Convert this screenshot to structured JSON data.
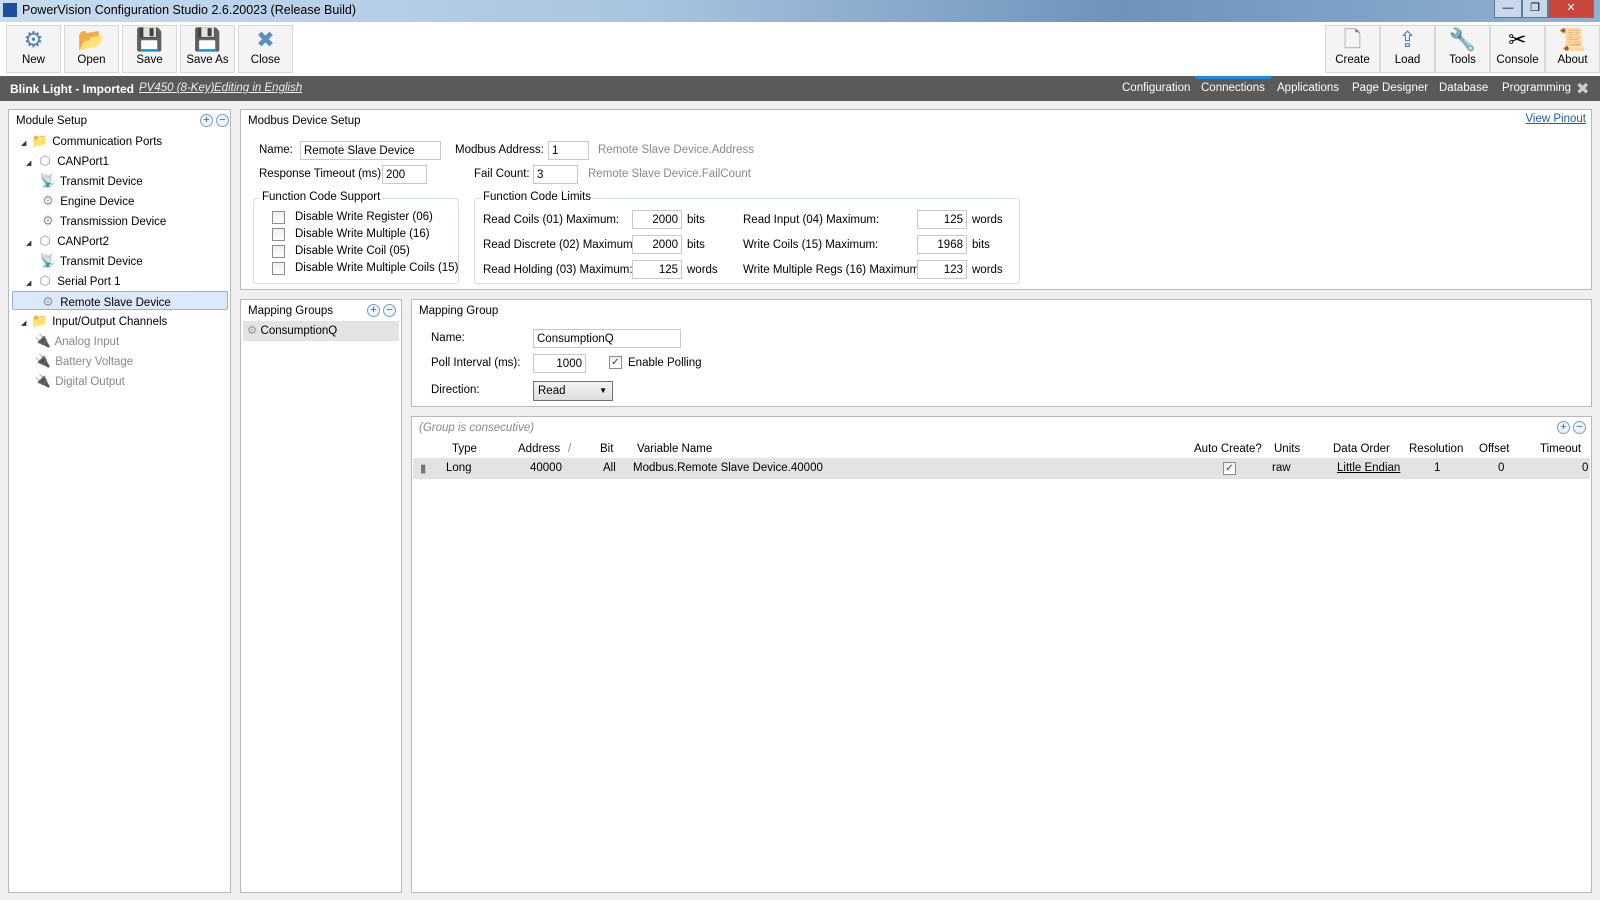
{
  "window": {
    "title": "PowerVision Configuration Studio 2.6.20023 (Release Build)",
    "minimize": "—",
    "restore": "❐",
    "close": "✕"
  },
  "toolbar": {
    "left": [
      {
        "label": "New",
        "icon": "gear-icon",
        "glyph": "⚙"
      },
      {
        "label": "Open",
        "icon": "folder-open-icon",
        "glyph": "📂"
      },
      {
        "label": "Save",
        "icon": "floppy-icon",
        "glyph": "💾"
      },
      {
        "label": "Save As",
        "icon": "floppy-pencil-icon",
        "glyph": "💾"
      },
      {
        "label": "Close",
        "icon": "close-x-icon",
        "glyph": "✖"
      }
    ],
    "right": [
      {
        "label": "Create",
        "icon": "new-file-icon",
        "glyph": "🗋"
      },
      {
        "label": "Load",
        "icon": "upload-icon",
        "glyph": "⇪"
      },
      {
        "label": "Tools",
        "icon": "tools-icon",
        "glyph": "🔧"
      },
      {
        "label": "Console",
        "icon": "screwdriver-wrench-icon",
        "glyph": "✂"
      },
      {
        "label": "About",
        "icon": "certificate-icon",
        "glyph": "📜"
      }
    ]
  },
  "project": {
    "name": "Blink Light - Imported",
    "device": "PV450 (8-Key)",
    "language": "Editing in English"
  },
  "nav": {
    "tabs": [
      "Configuration",
      "Connections",
      "Applications",
      "Page Designer",
      "Database",
      "Programming"
    ],
    "active": "Connections",
    "close": "✖"
  },
  "module_setup": {
    "title": "Module Setup",
    "items": [
      {
        "label": "Communication Ports",
        "icon": "folder-icon",
        "glyph": "📁"
      },
      {
        "label": "CANPort1",
        "icon": "port-icon",
        "glyph": "⬡"
      },
      {
        "label": "Transmit Device",
        "icon": "transmit-icon",
        "glyph": "📡"
      },
      {
        "label": "Engine Device",
        "icon": "gear-icon",
        "glyph": "⚙"
      },
      {
        "label": "Transmission Device",
        "icon": "gear-icon",
        "glyph": "⚙"
      },
      {
        "label": "CANPort2",
        "icon": "port-icon",
        "glyph": "⬡"
      },
      {
        "label": "Transmit Device",
        "icon": "transmit-icon",
        "glyph": "📡"
      },
      {
        "label": "Serial Port 1",
        "icon": "port-icon",
        "glyph": "⬡"
      },
      {
        "label": "Remote Slave Device",
        "icon": "gear-icon",
        "glyph": "⚙"
      },
      {
        "label": "Input/Output Channels",
        "icon": "io-folder-icon",
        "glyph": "📁"
      },
      {
        "label": "Analog Input",
        "icon": "plug-icon",
        "glyph": "🔌"
      },
      {
        "label": "Battery Voltage",
        "icon": "plug-icon",
        "glyph": "🔌"
      },
      {
        "label": "Digital Output",
        "icon": "plug-icon",
        "glyph": "🔌"
      }
    ],
    "selected": "Remote Slave Device"
  },
  "device_setup": {
    "title": "Modbus Device Setup",
    "view_pinout": "View Pinout",
    "name_label": "Name:",
    "name": "Remote Slave Device",
    "address_label": "Modbus Address:",
    "address": "1",
    "address_var": "Remote Slave Device.Address",
    "timeout_label": "Response Timeout (ms):",
    "timeout": "200",
    "fail_label": "Fail Count:",
    "fail": "3",
    "fail_var": "Remote Slave Device.FailCount",
    "fcs_title": "Function Code Support",
    "fcs": [
      {
        "label": "Disable Write Register (06)",
        "checked": false
      },
      {
        "label": "Disable Write Multiple (16)",
        "checked": false
      },
      {
        "label": "Disable Write Coil (05)",
        "checked": false
      },
      {
        "label": "Disable Write Multiple Coils (15)",
        "checked": false
      }
    ],
    "fcl_title": "Function Code Limits",
    "limits": [
      {
        "label": "Read Coils (01) Maximum:",
        "value": "2000",
        "unit": "bits"
      },
      {
        "label": "Read Discrete (02) Maximum:",
        "value": "2000",
        "unit": "bits"
      },
      {
        "label": "Read Holding (03) Maximum:",
        "value": "125",
        "unit": "words"
      },
      {
        "label": "Read Input (04) Maximum:",
        "value": "125",
        "unit": "words"
      },
      {
        "label": "Write Coils (15) Maximum:",
        "value": "1968",
        "unit": "bits"
      },
      {
        "label": "Write Multiple Regs (16) Maximum:",
        "value": "123",
        "unit": "words"
      }
    ]
  },
  "mapping_groups": {
    "title": "Mapping Groups",
    "items": [
      "ConsumptionQ"
    ]
  },
  "mapping_group": {
    "title": "Mapping Group",
    "name_label": "Name:",
    "name": "ConsumptionQ",
    "poll_label": "Poll Interval (ms):",
    "poll": "1000",
    "enable_label": "Enable Polling",
    "enable": true,
    "direction_label": "Direction:",
    "direction": "Read"
  },
  "table": {
    "note": "(Group is consecutive)",
    "columns": [
      "Type",
      "Address",
      "Bit",
      "Variable Name",
      "Auto Create?",
      "Units",
      "Data Order",
      "Resolution",
      "Offset",
      "Timeout"
    ],
    "sort_indicator": "/",
    "rows": [
      {
        "type": "Long",
        "address": "40000",
        "bit": "All",
        "variable": "Modbus.Remote Slave Device.40000",
        "auto_create": true,
        "units": "raw",
        "data_order": "Little Endian",
        "resolution": "1",
        "offset": "0",
        "timeout": "0"
      }
    ]
  }
}
